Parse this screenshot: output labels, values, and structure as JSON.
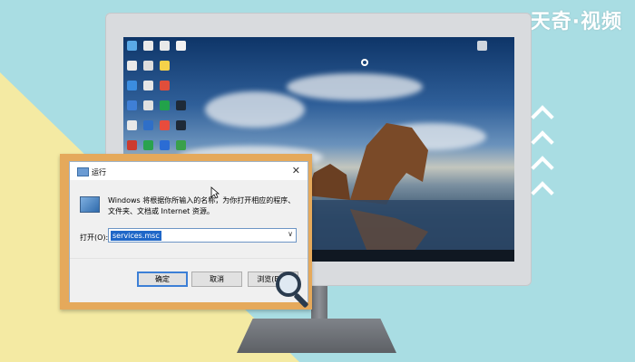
{
  "watermark": "天奇·视频",
  "run_dialog": {
    "title": "运行",
    "close_glyph": "✕",
    "description": "Windows 将根据你所输入的名称，为你打开相应的程序、文件夹、文档或 Internet 资源。",
    "open_label": "打开(O):",
    "open_value": "services.msc",
    "ok_button": "确定",
    "cancel_button": "取消",
    "browse_button": "浏览(B)..."
  },
  "colors": {
    "background": "#a9dde3",
    "accent_yellow": "#f4eaa3",
    "frame_wood": "#e5a95b",
    "selection_blue": "#1f67c8"
  }
}
